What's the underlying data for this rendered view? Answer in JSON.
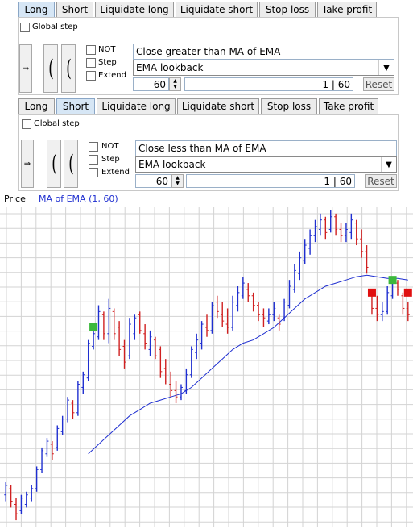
{
  "long_panel": {
    "tabs": [
      "Long",
      "Short",
      "Liquidate long",
      "Liquidate short",
      "Stop loss",
      "Take profit"
    ],
    "active_tab": "Long",
    "global_step_label": "Global step",
    "not_label": "NOT",
    "step_label": "Step",
    "extend_label": "Extend",
    "condition": "Close greater than MA of EMA",
    "indicator": "EMA lookback",
    "value": "60",
    "range_text": "1  |  60",
    "reset_label": "Reset"
  },
  "short_panel": {
    "tabs": [
      "Long",
      "Short",
      "Liquidate long",
      "Liquidate short",
      "Stop loss",
      "Take profit"
    ],
    "active_tab": "Short",
    "global_step_label": "Global step",
    "not_label": "NOT",
    "step_label": "Step",
    "extend_label": "Extend",
    "condition": "Close less than MA of EMA",
    "indicator": "EMA lookback",
    "value": "60",
    "range_text": "1  |  60",
    "reset_label": "Reset"
  },
  "icons": {
    "arrow": "right-arrow-icon",
    "dropdown": "chevron-down-icon",
    "spinner": "spinner-icon"
  },
  "chart_data": {
    "type": "bar",
    "legend": [
      "Price",
      "MA of EMA (1, 60)"
    ],
    "colors": {
      "up": "#1f2fd0",
      "down": "#d02020",
      "ma": "#1f2fd0",
      "grid": "#d3d3d3",
      "buy": "#3cb83c",
      "sell": "#e01010"
    },
    "ylim": [
      0,
      100
    ],
    "grid": true,
    "ohlc": [
      {
        "high": 13,
        "low": 7,
        "open": 9,
        "close": 12
      },
      {
        "high": 12,
        "low": 5,
        "open": 11,
        "close": 7
      },
      {
        "high": 8,
        "low": 1,
        "open": 6,
        "close": 3
      },
      {
        "high": 9,
        "low": 3,
        "open": 4,
        "close": 8
      },
      {
        "high": 10,
        "low": 5,
        "open": 6,
        "close": 9
      },
      {
        "high": 12,
        "low": 7,
        "open": 8,
        "close": 11
      },
      {
        "high": 18,
        "low": 10,
        "open": 11,
        "close": 17
      },
      {
        "high": 24,
        "low": 16,
        "open": 17,
        "close": 23
      },
      {
        "high": 27,
        "low": 21,
        "open": 22,
        "close": 26
      },
      {
        "high": 26,
        "low": 20,
        "open": 25,
        "close": 22
      },
      {
        "high": 31,
        "low": 23,
        "open": 24,
        "close": 30
      },
      {
        "high": 34,
        "low": 28,
        "open": 29,
        "close": 33
      },
      {
        "high": 40,
        "low": 32,
        "open": 33,
        "close": 39
      },
      {
        "high": 39,
        "low": 33,
        "open": 38,
        "close": 35
      },
      {
        "high": 45,
        "low": 34,
        "open": 35,
        "close": 44
      },
      {
        "high": 48,
        "low": 41,
        "open": 43,
        "close": 47
      },
      {
        "high": 58,
        "low": 45,
        "open": 46,
        "close": 57
      },
      {
        "high": 62,
        "low": 55,
        "open": 56,
        "close": 60
      },
      {
        "high": 69,
        "low": 58,
        "open": 59,
        "close": 67
      },
      {
        "high": 67,
        "low": 58,
        "open": 66,
        "close": 60
      },
      {
        "high": 71,
        "low": 57,
        "open": 60,
        "close": 68
      },
      {
        "high": 68,
        "low": 58,
        "open": 67,
        "close": 60
      },
      {
        "high": 64,
        "low": 53,
        "open": 62,
        "close": 55
      },
      {
        "high": 58,
        "low": 49,
        "open": 56,
        "close": 51
      },
      {
        "high": 65,
        "low": 52,
        "open": 53,
        "close": 63
      },
      {
        "high": 66,
        "low": 58,
        "open": 60,
        "close": 65
      },
      {
        "high": 67,
        "low": 60,
        "open": 66,
        "close": 61
      },
      {
        "high": 63,
        "low": 55,
        "open": 60,
        "close": 57
      },
      {
        "high": 61,
        "low": 53,
        "open": 55,
        "close": 59
      },
      {
        "high": 59,
        "low": 52,
        "open": 58,
        "close": 53
      },
      {
        "high": 56,
        "low": 46,
        "open": 55,
        "close": 48
      },
      {
        "high": 52,
        "low": 44,
        "open": 49,
        "close": 45
      },
      {
        "high": 48,
        "low": 40,
        "open": 44,
        "close": 42
      },
      {
        "high": 45,
        "low": 38,
        "open": 42,
        "close": 40
      },
      {
        "high": 44,
        "low": 39,
        "open": 40,
        "close": 43
      },
      {
        "high": 49,
        "low": 41,
        "open": 42,
        "close": 47
      },
      {
        "high": 56,
        "low": 46,
        "open": 47,
        "close": 55
      },
      {
        "high": 60,
        "low": 52,
        "open": 54,
        "close": 58
      },
      {
        "high": 64,
        "low": 55,
        "open": 57,
        "close": 63
      },
      {
        "high": 66,
        "low": 59,
        "open": 62,
        "close": 61
      },
      {
        "high": 70,
        "low": 60,
        "open": 61,
        "close": 69
      },
      {
        "high": 72,
        "low": 65,
        "open": 70,
        "close": 67
      },
      {
        "high": 70,
        "low": 62,
        "open": 66,
        "close": 64
      },
      {
        "high": 68,
        "low": 60,
        "open": 63,
        "close": 62
      },
      {
        "high": 72,
        "low": 61,
        "open": 62,
        "close": 70
      },
      {
        "high": 75,
        "low": 67,
        "open": 69,
        "close": 73
      },
      {
        "high": 78,
        "low": 71,
        "open": 72,
        "close": 76
      },
      {
        "high": 76,
        "low": 70,
        "open": 74,
        "close": 72
      },
      {
        "high": 73,
        "low": 67,
        "open": 72,
        "close": 69
      },
      {
        "high": 70,
        "low": 64,
        "open": 69,
        "close": 66
      },
      {
        "high": 68,
        "low": 62,
        "open": 66,
        "close": 65
      },
      {
        "high": 68,
        "low": 63,
        "open": 64,
        "close": 66
      },
      {
        "high": 70,
        "low": 64,
        "open": 66,
        "close": 68
      },
      {
        "high": 66,
        "low": 61,
        "open": 65,
        "close": 63
      },
      {
        "high": 71,
        "low": 64,
        "open": 65,
        "close": 70
      },
      {
        "high": 77,
        "low": 68,
        "open": 69,
        "close": 75
      },
      {
        "high": 82,
        "low": 73,
        "open": 74,
        "close": 80
      },
      {
        "high": 86,
        "low": 77,
        "open": 79,
        "close": 84
      },
      {
        "high": 90,
        "low": 82,
        "open": 83,
        "close": 88
      },
      {
        "high": 93,
        "low": 85,
        "open": 87,
        "close": 91
      },
      {
        "high": 96,
        "low": 89,
        "open": 91,
        "close": 94
      },
      {
        "high": 98,
        "low": 91,
        "open": 93,
        "close": 96
      },
      {
        "high": 97,
        "low": 90,
        "open": 96,
        "close": 92
      },
      {
        "high": 99,
        "low": 92,
        "open": 93,
        "close": 97
      },
      {
        "high": 98,
        "low": 91,
        "open": 97,
        "close": 93
      },
      {
        "high": 95,
        "low": 89,
        "open": 93,
        "close": 91
      },
      {
        "high": 95,
        "low": 89,
        "open": 91,
        "close": 93
      },
      {
        "high": 98,
        "low": 90,
        "open": 92,
        "close": 96
      },
      {
        "high": 96,
        "low": 88,
        "open": 95,
        "close": 90
      },
      {
        "high": 93,
        "low": 84,
        "open": 90,
        "close": 86
      },
      {
        "high": 88,
        "low": 79,
        "open": 86,
        "close": 81
      },
      {
        "high": 74,
        "low": 66,
        "open": 73,
        "close": 68
      },
      {
        "high": 72,
        "low": 64,
        "open": 68,
        "close": 66
      },
      {
        "high": 70,
        "low": 64,
        "open": 66,
        "close": 67
      },
      {
        "high": 75,
        "low": 66,
        "open": 67,
        "close": 73
      },
      {
        "high": 78,
        "low": 71,
        "open": 72,
        "close": 76
      },
      {
        "high": 77,
        "low": 72,
        "open": 76,
        "close": 74
      },
      {
        "high": 73,
        "low": 66,
        "open": 72,
        "close": 68
      },
      {
        "high": 70,
        "low": 64,
        "open": 68,
        "close": 66
      }
    ],
    "ma": [
      {
        "i": 16,
        "v": 22
      },
      {
        "i": 18,
        "v": 25
      },
      {
        "i": 20,
        "v": 28
      },
      {
        "i": 22,
        "v": 31
      },
      {
        "i": 24,
        "v": 34
      },
      {
        "i": 26,
        "v": 36
      },
      {
        "i": 28,
        "v": 38
      },
      {
        "i": 30,
        "v": 39
      },
      {
        "i": 32,
        "v": 40
      },
      {
        "i": 34,
        "v": 41
      },
      {
        "i": 36,
        "v": 43
      },
      {
        "i": 38,
        "v": 46
      },
      {
        "i": 40,
        "v": 49
      },
      {
        "i": 42,
        "v": 52
      },
      {
        "i": 44,
        "v": 55
      },
      {
        "i": 46,
        "v": 57
      },
      {
        "i": 48,
        "v": 58
      },
      {
        "i": 50,
        "v": 60
      },
      {
        "i": 52,
        "v": 62
      },
      {
        "i": 54,
        "v": 65
      },
      {
        "i": 56,
        "v": 68
      },
      {
        "i": 58,
        "v": 71
      },
      {
        "i": 60,
        "v": 73
      },
      {
        "i": 62,
        "v": 75
      },
      {
        "i": 64,
        "v": 76
      },
      {
        "i": 66,
        "v": 77
      },
      {
        "i": 68,
        "v": 78
      },
      {
        "i": 70,
        "v": 78.5
      },
      {
        "i": 72,
        "v": 78
      },
      {
        "i": 74,
        "v": 77.5
      },
      {
        "i": 76,
        "v": 77.5
      },
      {
        "i": 78,
        "v": 77
      }
    ],
    "signals": [
      {
        "i": 17,
        "price": 62,
        "kind": "buy"
      },
      {
        "i": 71,
        "price": 73,
        "kind": "sell"
      },
      {
        "i": 75,
        "price": 77,
        "kind": "buy"
      },
      {
        "i": 78,
        "price": 73,
        "kind": "sell"
      }
    ]
  }
}
